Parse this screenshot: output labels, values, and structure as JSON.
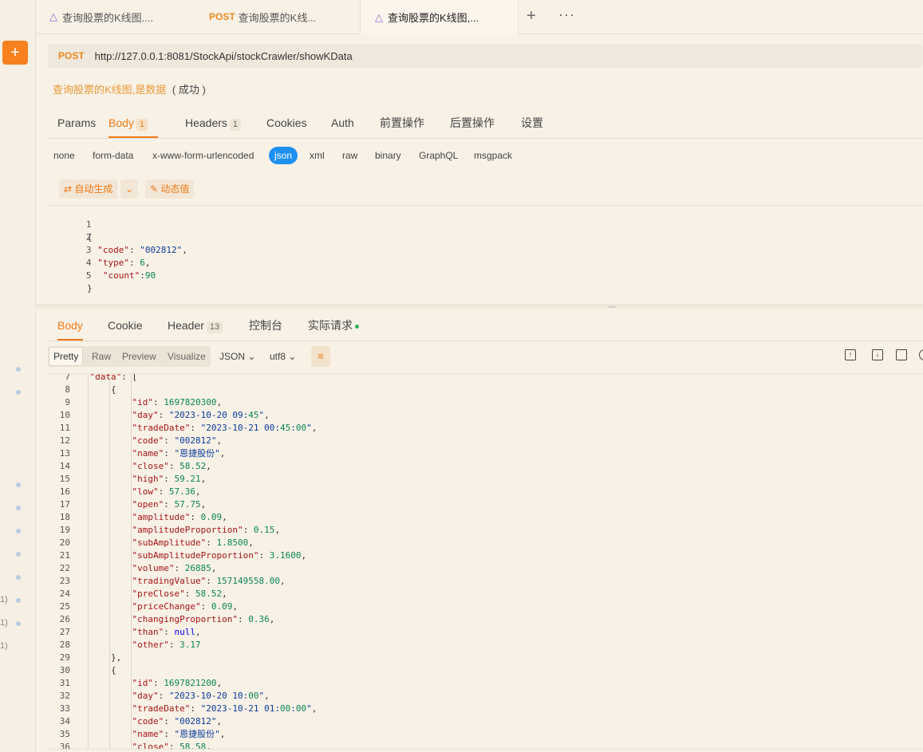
{
  "sidebar": {
    "add_label": "+",
    "fragments": [
      "1)",
      "1)",
      "1)"
    ]
  },
  "tabs": [
    {
      "method": "",
      "icon": "graphql-icon",
      "title": "查询股票的K线图...."
    },
    {
      "method": "POST",
      "icon": "",
      "title": "查询股票的K线..."
    },
    {
      "method": "",
      "icon": "graphql-icon",
      "title": "查询股票的K线图,..."
    }
  ],
  "tab_actions": {
    "add": "+",
    "more": "···"
  },
  "request": {
    "method": "POST",
    "url": "http://127.0.0.1:8081/StockApi/stockCrawler/showKData",
    "api_name": "查询股票的K线图,是数据",
    "api_status": "( 成功 )"
  },
  "request_tabs": [
    {
      "label": "Params",
      "badge": ""
    },
    {
      "label": "Body",
      "badge": "1"
    },
    {
      "label": "Headers",
      "badge": "1"
    },
    {
      "label": "Cookies",
      "badge": ""
    },
    {
      "label": "Auth",
      "badge": ""
    },
    {
      "label": "前置操作",
      "badge": ""
    },
    {
      "label": "后置操作",
      "badge": ""
    },
    {
      "label": "设置",
      "badge": ""
    }
  ],
  "body_types": [
    "none",
    "form-data",
    "x-www-form-urlencoded",
    "json",
    "xml",
    "raw",
    "binary",
    "GraphQL",
    "msgpack"
  ],
  "body_tools": {
    "auto_generate": "⇄ 自动生成",
    "dropdown": "⌄",
    "dynamic_value": "✎ 动态值"
  },
  "request_body_lines": [
    {
      "n": "1",
      "text": "{"
    },
    {
      "n": "2",
      "text": "  \"code\": \"002812\","
    },
    {
      "n": "3",
      "text": "  \"type\": 6,"
    },
    {
      "n": "4",
      "text": "   \"count\":90"
    },
    {
      "n": "5",
      "text": "}"
    }
  ],
  "splitter_grip": "···",
  "response_tabs": [
    {
      "label": "Body",
      "badge": ""
    },
    {
      "label": "Cookie",
      "badge": ""
    },
    {
      "label": "Header",
      "badge": "13"
    },
    {
      "label": "控制台",
      "badge": ""
    },
    {
      "label": "实际请求",
      "badge": ""
    }
  ],
  "response_view": {
    "modes": [
      "Pretty",
      "Raw",
      "Preview",
      "Visualize"
    ],
    "format": "JSON",
    "encoding": "utf8",
    "wrap_icon": "≡"
  },
  "response_lines": [
    {
      "n": "7",
      "indent": 1,
      "text": "\"data\": ["
    },
    {
      "n": "8",
      "indent": 2,
      "text": "{"
    },
    {
      "n": "9",
      "indent": 3,
      "text": "\"id\": 1697820300,"
    },
    {
      "n": "10",
      "indent": 3,
      "text": "\"day\": \"2023-10-20 09:45\","
    },
    {
      "n": "11",
      "indent": 3,
      "text": "\"tradeDate\": \"2023-10-21 00:45:00\","
    },
    {
      "n": "12",
      "indent": 3,
      "text": "\"code\": \"002812\","
    },
    {
      "n": "13",
      "indent": 3,
      "text": "\"name\": \"恩捷股份\","
    },
    {
      "n": "14",
      "indent": 3,
      "text": "\"close\": 58.52,"
    },
    {
      "n": "15",
      "indent": 3,
      "text": "\"high\": 59.21,"
    },
    {
      "n": "16",
      "indent": 3,
      "text": "\"low\": 57.36,"
    },
    {
      "n": "17",
      "indent": 3,
      "text": "\"open\": 57.75,"
    },
    {
      "n": "18",
      "indent": 3,
      "text": "\"amplitude\": 0.09,"
    },
    {
      "n": "19",
      "indent": 3,
      "text": "\"amplitudeProportion\": 0.15,"
    },
    {
      "n": "20",
      "indent": 3,
      "text": "\"subAmplitude\": 1.8500,"
    },
    {
      "n": "21",
      "indent": 3,
      "text": "\"subAmplitudeProportion\": 3.1600,"
    },
    {
      "n": "22",
      "indent": 3,
      "text": "\"volume\": 26885,"
    },
    {
      "n": "23",
      "indent": 3,
      "text": "\"tradingValue\": 157149558.00,"
    },
    {
      "n": "24",
      "indent": 3,
      "text": "\"preClose\": 58.52,"
    },
    {
      "n": "25",
      "indent": 3,
      "text": "\"priceChange\": 0.09,"
    },
    {
      "n": "26",
      "indent": 3,
      "text": "\"changingProportion\": 0.36,"
    },
    {
      "n": "27",
      "indent": 3,
      "text": "\"than\": null,"
    },
    {
      "n": "28",
      "indent": 3,
      "text": "\"other\": 3.17"
    },
    {
      "n": "29",
      "indent": 2,
      "text": "},"
    },
    {
      "n": "30",
      "indent": 2,
      "text": "{"
    },
    {
      "n": "31",
      "indent": 3,
      "text": "\"id\": 1697821200,"
    },
    {
      "n": "32",
      "indent": 3,
      "text": "\"day\": \"2023-10-20 10:00\","
    },
    {
      "n": "33",
      "indent": 3,
      "text": "\"tradeDate\": \"2023-10-21 01:00:00\","
    },
    {
      "n": "34",
      "indent": 3,
      "text": "\"code\": \"002812\","
    },
    {
      "n": "35",
      "indent": 3,
      "text": "\"name\": \"恩捷股份\","
    },
    {
      "n": "36",
      "indent": 3,
      "text": "\"close\": 58.58,"
    }
  ],
  "colors": {
    "accent": "#f07a18",
    "json_key": "#a31515",
    "json_string": "#0a3c9c",
    "json_number": "#098658",
    "json_keyword": "#0000ff",
    "active_pill": "#1f8ff0"
  }
}
